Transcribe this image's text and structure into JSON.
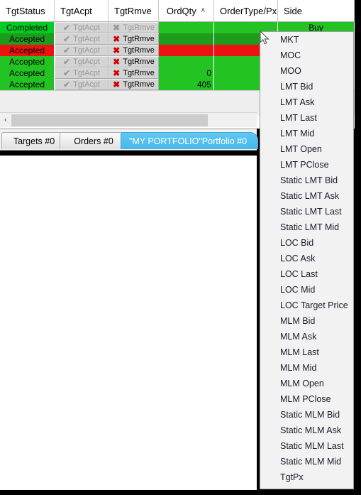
{
  "grid": {
    "columns": [
      {
        "label": "TgtStatus",
        "width": 77,
        "align": "left"
      },
      {
        "label": "TgtAcpt",
        "width": 76,
        "align": "left"
      },
      {
        "label": "TgtRmve",
        "width": 71,
        "align": "left"
      },
      {
        "label": "OrdQty",
        "width": 78,
        "align": "center",
        "sort": "∧"
      },
      {
        "label": "OrderType/Px",
        "width": 90,
        "align": "left"
      },
      {
        "label": "Side",
        "width": 108,
        "align": "left"
      }
    ],
    "rows": [
      {
        "status": "Completed",
        "status_color": "#00cc22",
        "accept_label": "TgtAcpt",
        "accept_enabled": false,
        "remove_label": "TgtRmve",
        "remove_enabled": false,
        "ordqty": "",
        "ordqty_color": "#22c322",
        "ordertype": "",
        "ordertype_color": "#22c322",
        "side": "Buy",
        "side_color": "#22c322"
      },
      {
        "status": "Accepted",
        "status_color": "#1c9b1c",
        "accept_label": "TgtAcpt",
        "accept_enabled": false,
        "remove_label": "TgtRmve",
        "remove_enabled": true,
        "ordqty": "",
        "ordqty_color": "#1c9b1c",
        "ordertype": "",
        "ordertype_color": "#1c9b1c",
        "side": "",
        "side_color": "#1c9b1c"
      },
      {
        "status": "Accepted",
        "status_color": "#ee1111",
        "accept_label": "TgtAcpt",
        "accept_enabled": false,
        "remove_label": "TgtRmve",
        "remove_enabled": true,
        "ordqty": "",
        "ordqty_color": "#ee1111",
        "ordertype": "",
        "ordertype_color": "#ee1111",
        "side": "",
        "side_color": "#ee1111"
      },
      {
        "status": "Accepted",
        "status_color": "#22c322",
        "accept_label": "TgtAcpt",
        "accept_enabled": false,
        "remove_label": "TgtRmve",
        "remove_enabled": true,
        "ordqty": "",
        "ordqty_color": "#22c322",
        "ordertype": "",
        "ordertype_color": "#22c322",
        "side": "",
        "side_color": "#22c322"
      },
      {
        "status": "Accepted",
        "status_color": "#22c322",
        "accept_label": "TgtAcpt",
        "accept_enabled": false,
        "remove_label": "TgtRmve",
        "remove_enabled": true,
        "ordqty": "0",
        "ordqty_color": "#22c322",
        "ordertype": "",
        "ordertype_color": "#22c322",
        "side": "",
        "side_color": "#22c322"
      },
      {
        "status": "Accepted",
        "status_color": "#22c322",
        "accept_label": "TgtAcpt",
        "accept_enabled": false,
        "remove_label": "TgtRmve",
        "remove_enabled": true,
        "ordqty": "405",
        "ordqty_color": "#22c322",
        "ordertype": "",
        "ordertype_color": "#22c322",
        "side": "",
        "side_color": "#22c322"
      }
    ],
    "icons": {
      "accept_check": "✔",
      "remove_cross": "✖"
    }
  },
  "scrollbar": {
    "left_arrow": "‹"
  },
  "tabs": [
    {
      "label": "Targets #0",
      "active": false
    },
    {
      "label": "Orders #0",
      "active": false
    },
    {
      "label": "\"MY PORTFOLIO\"Portfolio #0",
      "active": true
    }
  ],
  "dropdown": {
    "items": [
      "MKT",
      "MOC",
      "MOO",
      "LMT Bid",
      "LMT Ask",
      "LMT Last",
      "LMT Mid",
      "LMT Open",
      "LMT PClose",
      "Static LMT Bid",
      "Static LMT Ask",
      "Static LMT Last",
      "Static LMT Mid",
      "LOC Bid",
      "LOC Ask",
      "LOC Last",
      "LOC Mid",
      "LOC Target Price",
      "MLM Bid",
      "MLM Ask",
      "MLM Last",
      "MLM Mid",
      "MLM Open",
      "MLM PClose",
      "Static MLM Bid",
      "Static MLM Ask",
      "Static MLM Last",
      "Static MLM Mid",
      "TgtPx"
    ]
  },
  "colors": {
    "accent_blue": "#45b8ec",
    "row_green": "#22c322",
    "row_green_dark": "#1c9b1c",
    "row_red": "#ee1111",
    "cross_red": "#cc0000"
  }
}
